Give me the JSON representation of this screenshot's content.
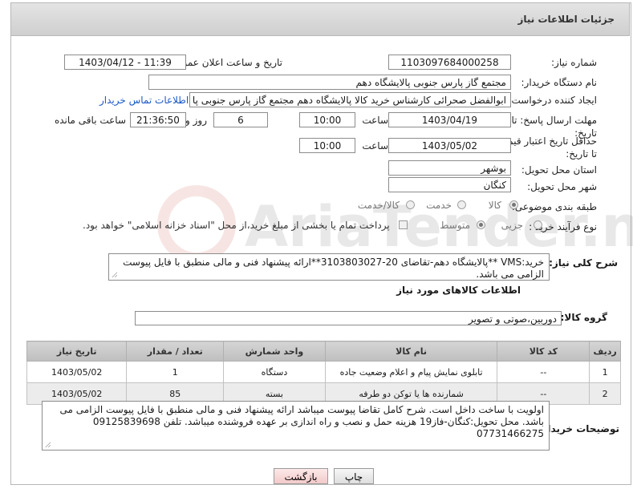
{
  "header": {
    "title": "جزئیات اطلاعات نیاز"
  },
  "fields": {
    "need_number_label": "شماره نیاز:",
    "need_number": "1103097684000258",
    "announce_label": "تاریخ و ساعت اعلان عمومی:",
    "announce_value": "1403/04/12 - 11:39",
    "buyer_org_label": "نام دستگاه خریدار:",
    "buyer_org": "مجتمع گاز پارس جنوبی  پالایشگاه دهم",
    "creator_label": "ایجاد کننده درخواست:",
    "creator": "ابوالفضل صحرائی کارشناس خرید کالا پالایشگاه دهم مجتمع گاز پارس جنوبی  پا",
    "contact_link": "اطلاعات تماس خریدار",
    "deadline_label": "مهلت ارسال پاسخ: تا تاریخ:",
    "deadline_date": "1403/04/19",
    "time_label": "ساعت",
    "deadline_time": "10:00",
    "days_value": "6",
    "days_label": "روز و",
    "remaining_time": "21:36:50",
    "remaining_label": "ساعت باقی مانده",
    "validity_label": "حداقل تاریخ اعتبار قیمت: تا تاریخ:",
    "validity_date": "1403/05/02",
    "validity_time": "10:00",
    "province_label": "استان محل تحویل:",
    "province": "بوشهر",
    "city_label": "شهر محل تحویل:",
    "city": "کنگان",
    "category_label": "طبقه بندی موضوعی:",
    "category_options": [
      "کالا",
      "خدمت",
      "کالا/خدمت"
    ],
    "process_label": "نوع فرآیند خرید :",
    "process_options": [
      "جزیی",
      "متوسط"
    ],
    "payment_note": "پرداخت تمام یا بخشی از مبلغ خرید،از محل \"اسناد خزانه اسلامی\" خواهد بود."
  },
  "description": {
    "label": "شرح کلی نیاز:",
    "text": "خرید:VMS **پالایشگاه دهم-تقاضای 20-3103803027**ارائه پیشنهاد فنی و مالی منطبق با فایل پیوست الزامی می باشد."
  },
  "goods": {
    "section_title": "اطلاعات کالاهای مورد نیاز",
    "group_label": "گروه کالا:",
    "group_value": "دوربین،صوتی و تصویر",
    "columns": [
      "ردیف",
      "کد کالا",
      "نام کالا",
      "واحد شمارش",
      "تعداد / مقدار",
      "تاریخ نیاز"
    ],
    "rows": [
      {
        "index": "1",
        "code": "--",
        "name": "تابلوی نمایش پیام و اعلام وضعیت جاده",
        "unit": "دستگاه",
        "qty": "1",
        "date": "1403/05/02"
      },
      {
        "index": "2",
        "code": "--",
        "name": "شمارنده ها یا توکن دو طرفه",
        "unit": "بسته",
        "qty": "85",
        "date": "1403/05/02"
      }
    ]
  },
  "buyer_notes": {
    "label": "توضیحات خریدار:",
    "text": "اولویت با ساخت داخل است. شرح کامل تقاضا پیوست میباشد ارائه پیشنهاد فنی و مالی منطبق با فایل پیوست الزامی می باشد. محل تحویل:کنگان-فاز19 هزینه حمل و نصب و راه اندازی بر عهده فروشنده میباشد. تلفن 09125839698 07731466275"
  },
  "buttons": {
    "print": "چاپ",
    "back": "بازگشت"
  },
  "watermark": {
    "text": "AriaTender.neT"
  }
}
